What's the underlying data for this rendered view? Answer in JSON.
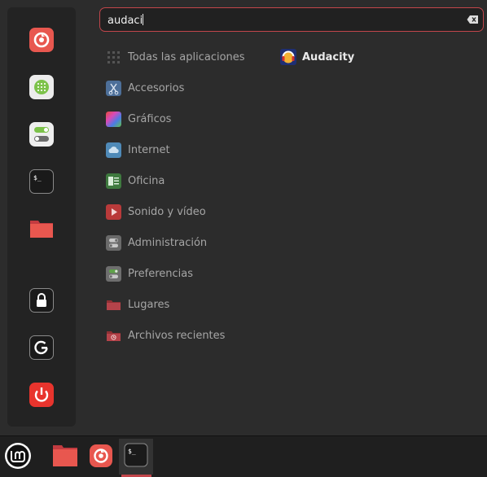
{
  "search": {
    "value": "audaci",
    "clear_icon": "backspace-clear-icon"
  },
  "favorites": [
    {
      "name": "firefox-icon"
    },
    {
      "name": "calculator-icon"
    },
    {
      "name": "settings-toggle-icon"
    },
    {
      "name": "terminal-icon"
    },
    {
      "name": "files-folder-icon"
    },
    {
      "name": "lock-screen-icon"
    },
    {
      "name": "logout-icon"
    },
    {
      "name": "power-icon"
    }
  ],
  "categories": [
    {
      "label": "Todas las aplicaciones",
      "icon": "grid-icon"
    },
    {
      "label": "Accesorios",
      "icon": "scissors-icon"
    },
    {
      "label": "Gráficos",
      "icon": "graphics-icon"
    },
    {
      "label": "Internet",
      "icon": "cloud-icon"
    },
    {
      "label": "Oficina",
      "icon": "office-icon"
    },
    {
      "label": "Sonido y vídeo",
      "icon": "media-play-icon"
    },
    {
      "label": "Administración",
      "icon": "admin-toggle-icon"
    },
    {
      "label": "Preferencias",
      "icon": "preferences-icon"
    },
    {
      "label": "Lugares",
      "icon": "folder-icon"
    },
    {
      "label": "Archivos recientes",
      "icon": "recent-folder-icon"
    }
  ],
  "results": [
    {
      "label": "Audacity",
      "icon": "audacity-icon"
    }
  ],
  "panel": {
    "items": [
      "mint-menu-icon",
      "files-folder-icon",
      "firefox-icon",
      "terminal-icon"
    ],
    "terminal_glyph": "$_"
  },
  "colors": {
    "accent": "#c2464b",
    "background": "#2c2c2c",
    "sidebar": "#232323"
  }
}
